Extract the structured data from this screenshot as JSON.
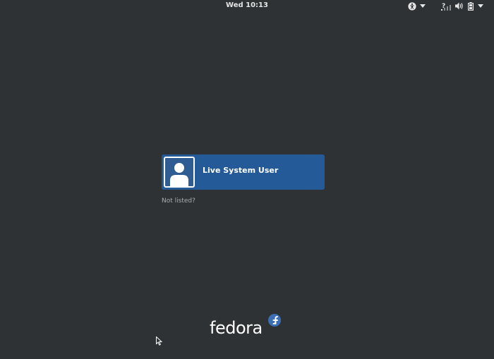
{
  "topbar": {
    "clock": "Wed 10:13",
    "icons": [
      "accessibility-icon",
      "chevron-down-icon",
      "network-question-icon",
      "volume-icon",
      "battery-icon",
      "chevron-down-icon"
    ]
  },
  "login": {
    "users": [
      {
        "name": "Live System User",
        "avatar": "user-icon"
      }
    ],
    "not_listed": "Not listed?"
  },
  "branding": {
    "logo_text": "fedora",
    "logo_mark": "fedora-infinity-icon"
  },
  "colors": {
    "background": "#2e3234",
    "selection": "#245a98",
    "text": "#ffffff",
    "muted_text": "#a9adae"
  }
}
